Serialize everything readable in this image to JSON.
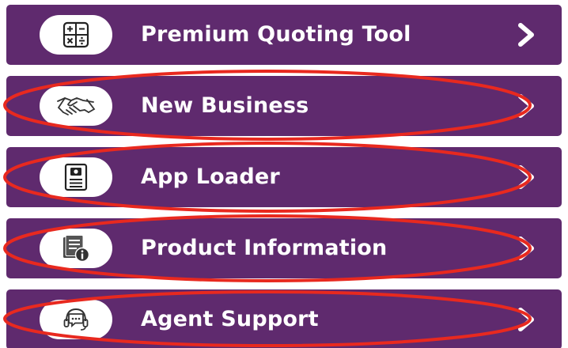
{
  "colors": {
    "item_background": "#5f2a6e",
    "highlight": "#e8291f",
    "text": "#ffffff"
  },
  "menu": {
    "items": [
      {
        "label": "Premium Quoting Tool",
        "icon": "calculator-icon",
        "highlighted": false
      },
      {
        "label": "New Business",
        "icon": "handshake-icon",
        "highlighted": true
      },
      {
        "label": "App Loader",
        "icon": "document-loader-icon",
        "highlighted": true
      },
      {
        "label": "Product Information",
        "icon": "document-info-icon",
        "highlighted": true
      },
      {
        "label": "Agent Support",
        "icon": "chat-headset-icon",
        "highlighted": true
      }
    ]
  }
}
